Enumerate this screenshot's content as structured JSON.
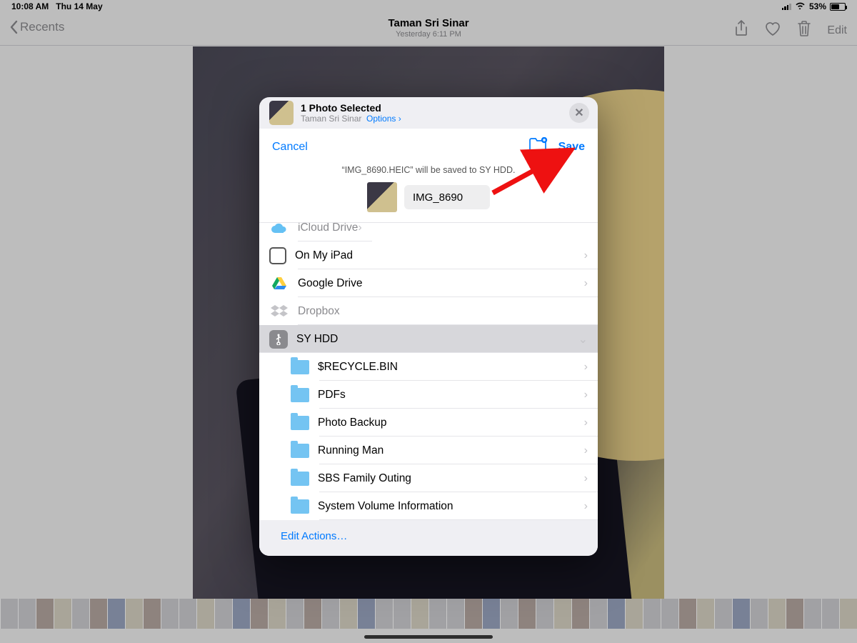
{
  "status": {
    "time": "10:08 AM",
    "date": "Thu 14 May",
    "battery": "53%"
  },
  "nav": {
    "back": "Recents",
    "title": "Taman Sri Sinar",
    "subtitle": "Yesterday  6:11 PM",
    "edit": "Edit"
  },
  "share_header": {
    "title": "1 Photo Selected",
    "subtitle": "Taman Sri Sinar",
    "options": "Options",
    "close": "✕"
  },
  "save_panel": {
    "cancel": "Cancel",
    "save": "Save",
    "message": "“IMG_8690.HEIC” will be saved to SY HDD.",
    "filename": "IMG_8690"
  },
  "locations": {
    "icloud": "iCloud Drive",
    "ipad": "On My iPad",
    "gdrive": "Google Drive",
    "dropbox": "Dropbox",
    "syhdd": "SY HDD"
  },
  "folders": [
    {
      "name": "$RECYCLE.BIN"
    },
    {
      "name": "PDFs"
    },
    {
      "name": "Photo Backup"
    },
    {
      "name": "Running Man"
    },
    {
      "name": "SBS Family Outing"
    },
    {
      "name": "System Volume Information"
    }
  ],
  "footer": {
    "edit_actions": "Edit Actions…"
  },
  "glyph": {
    "chevron_right": "›",
    "chevron_down": "⌄",
    "wifi": "􀙇"
  }
}
